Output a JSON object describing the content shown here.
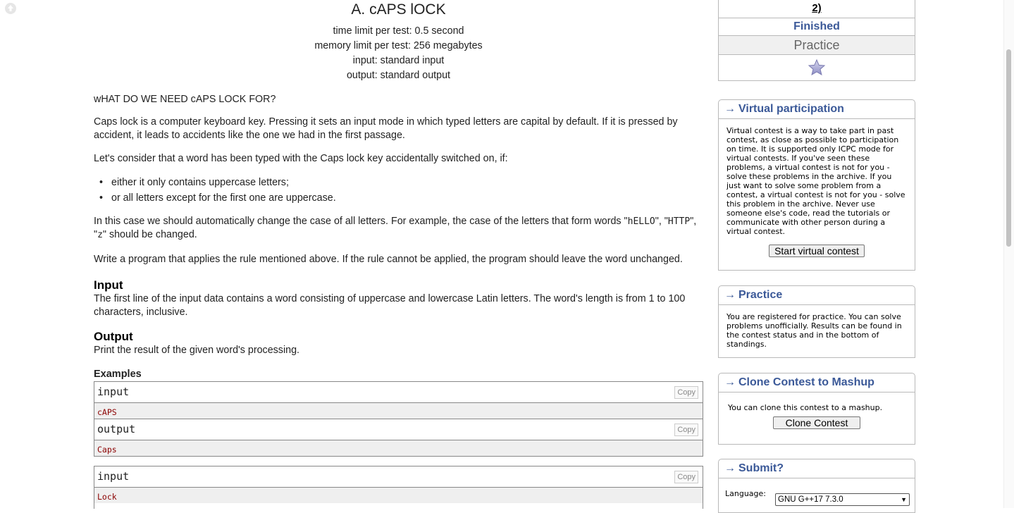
{
  "problem": {
    "title": "A. cAPS lOCK",
    "limits": [
      "time limit per test: 0.5 second",
      "memory limit per test: 256 megabytes",
      "input: standard input",
      "output: standard output"
    ],
    "legend_1": "wHAT DO WE NEED cAPS LOCK FOR?",
    "legend_2": "Caps lock is a computer keyboard key. Pressing it sets an input mode in which typed letters are capital by default. If it is pressed by accident, it leads to accidents like the one we had in the first passage.",
    "legend_3": "Let's consider that a word has been typed with the Caps lock key accidentally switched on, if:",
    "bullets": [
      "either it only contains uppercase letters;",
      "or all letters except for the first one are uppercase."
    ],
    "legend_4_prefix": "In this case we should automatically change the case of all letters. For example, the case of the letters that form words \"",
    "legend_4_ex1": "hELLO",
    "legend_4_mid1": "\", \"",
    "legend_4_ex2": "HTTP",
    "legend_4_mid2": "\", \"",
    "legend_4_ex3": "z",
    "legend_4_suffix": "\" should be changed.",
    "legend_5": "Write a program that applies the rule mentioned above. If the rule cannot be applied, the program should leave the word unchanged.",
    "input_title": "Input",
    "input_text": "The first line of the input data contains a word consisting of uppercase and lowercase Latin letters. The word's length is from 1 to 100 characters, inclusive.",
    "output_title": "Output",
    "output_text": "Print the result of the given word's processing.",
    "examples_title": "Examples",
    "examples": [
      {
        "input_label": "input",
        "input_value": "cAPS",
        "output_label": "output",
        "output_value": "Caps",
        "copy": "Copy"
      },
      {
        "input_label": "input",
        "input_value": "Lock",
        "copy": "Copy"
      }
    ]
  },
  "sidebar": {
    "contest": {
      "name_tail": "2)",
      "phase": "Finished",
      "mode": "Practice"
    },
    "virtual": {
      "title": "Virtual participation",
      "text": "Virtual contest is a way to take part in past contest, as close as possible to participation on time. It is supported only ICPC mode for virtual contests. If you've seen these problems, a virtual contest is not for you - solve these problems in the archive. If you just want to solve some problem from a contest, a virtual contest is not for you - solve this problem in the archive. Never use someone else's code, read the tutorials or communicate with other person during a virtual contest.",
      "button": "Start virtual contest"
    },
    "practice": {
      "title": "Practice",
      "text": "You are registered for practice. You can solve problems unofficially. Results can be found in the contest status and in the bottom of standings."
    },
    "clone": {
      "title": "Clone Contest to Mashup",
      "text": "You can clone this contest to a mashup.",
      "button": "Clone Contest"
    },
    "submit": {
      "title": "Submit?",
      "language_label": "Language:",
      "language_value": "GNU G++17 7.3.0"
    },
    "arrow": "→"
  },
  "colors": {
    "link_blue": "#3b5998",
    "sample_value": "#8b0000"
  }
}
